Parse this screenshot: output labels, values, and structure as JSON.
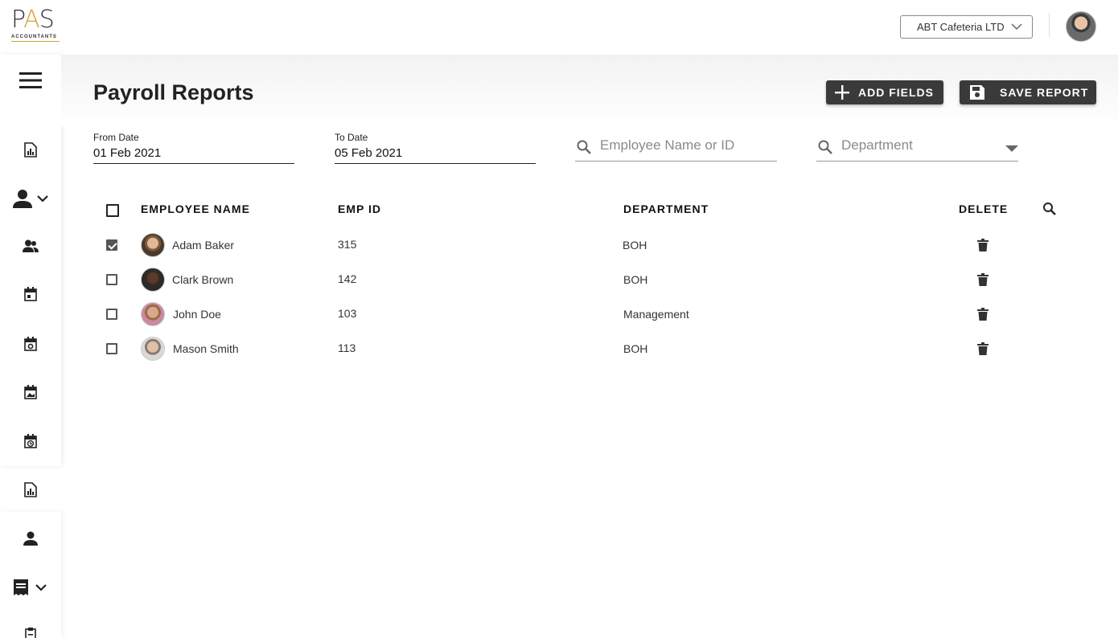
{
  "header": {
    "logo": {
      "text": "PAS",
      "sub": "ACCOUNTANTS"
    },
    "company_select": "ABT Cafeteria LTD"
  },
  "sidebar": {
    "items": [
      {
        "icon": "menu-icon"
      },
      {
        "icon": "report-icon"
      },
      {
        "icon": "person-icon"
      },
      {
        "icon": "people-icon"
      },
      {
        "icon": "calendar-icon"
      },
      {
        "icon": "calendar-check-icon"
      },
      {
        "icon": "calendar-image-icon"
      },
      {
        "icon": "calendar-clock-icon"
      },
      {
        "icon": "report-icon"
      },
      {
        "icon": "person-icon"
      },
      {
        "icon": "receipt-icon"
      },
      {
        "icon": "clipboard-icon"
      }
    ]
  },
  "page": {
    "title": "Payroll Reports",
    "add_fields_label": "ADD FIELDS",
    "save_report_label": "SAVE REPORT"
  },
  "filters": {
    "from_label": "From Date",
    "from_value": "01 Feb 2021",
    "to_label": "To Date",
    "to_value": "05 Feb 2021",
    "employee_placeholder": "Employee Name or ID",
    "department_placeholder": "Department"
  },
  "table": {
    "headers": {
      "name": "EMPLOYEE NAME",
      "id": "EMP ID",
      "department": "DEPARTMENT",
      "delete": "DELETE"
    },
    "rows": [
      {
        "name": "Adam Baker",
        "id": "315",
        "department": "BOH",
        "checked": true
      },
      {
        "name": "Clark Brown",
        "id": "142",
        "department": "BOH",
        "checked": false
      },
      {
        "name": "John Doe",
        "id": "103",
        "department": "Management",
        "checked": false
      },
      {
        "name": "Mason Smith",
        "id": "113",
        "department": "BOH",
        "checked": false
      }
    ]
  },
  "colors": {
    "button_bg": "#3a3a3a",
    "logo_accent": "#d6a33a"
  }
}
